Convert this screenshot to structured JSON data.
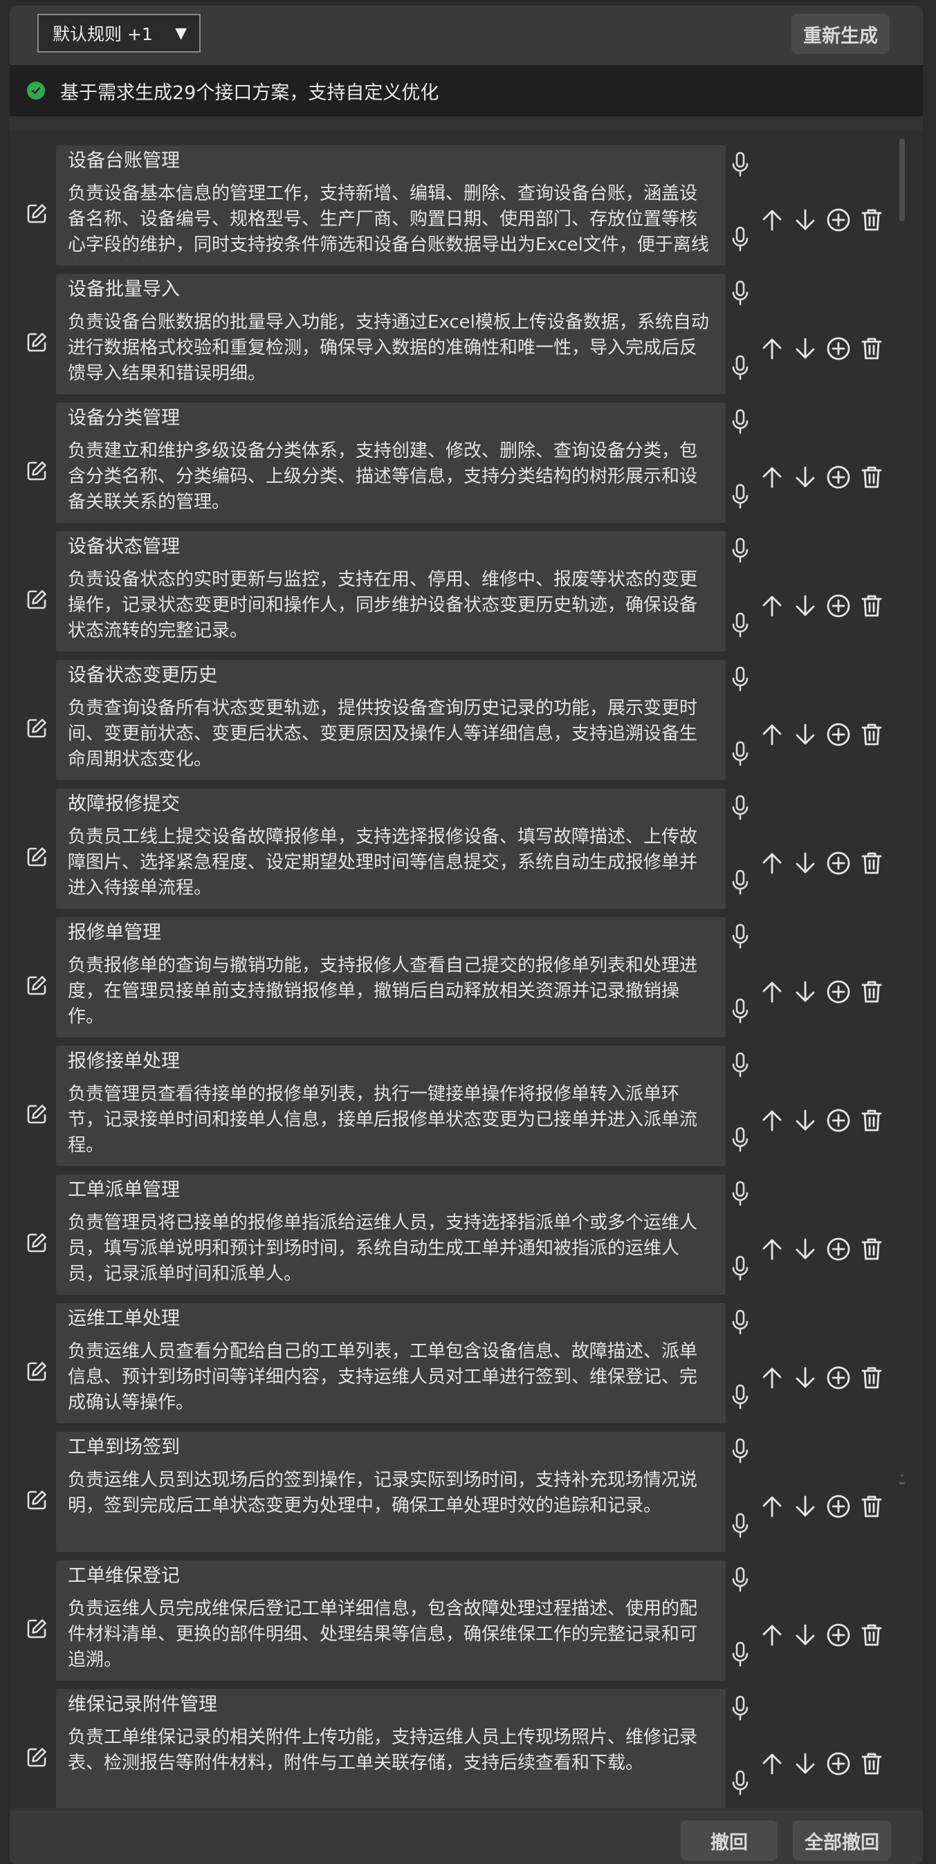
{
  "toolbar": {
    "rule_select_value": "默认规则 +1",
    "regenerate_label": "重新生成"
  },
  "status": {
    "message": "基于需求生成29个接口方案，支持自定义优化",
    "icon": "check-circle-icon",
    "color": "#2eaa4a"
  },
  "items": [
    {
      "title": "设备台账管理",
      "description": "负责设备基本信息的管理工作，支持新增、编辑、删除、查询设备台账，涵盖设备名称、设备编号、规格型号、生产厂商、购置日期、使用部门、存放位置等核心字段的维护，同时支持按条件筛选和设备台账数据导出为Excel文件，便于离线查看和数据备份。"
    },
    {
      "title": "设备批量导入",
      "description": "负责设备台账数据的批量导入功能，支持通过Excel模板上传设备数据，系统自动进行数据格式校验和重复检测，确保导入数据的准确性和唯一性，导入完成后反馈导入结果和错误明细。"
    },
    {
      "title": "设备分类管理",
      "description": "负责建立和维护多级设备分类体系，支持创建、修改、删除、查询设备分类，包含分类名称、分类编码、上级分类、描述等信息，支持分类结构的树形展示和设备关联关系的管理。"
    },
    {
      "title": "设备状态管理",
      "description": "负责设备状态的实时更新与监控，支持在用、停用、维修中、报废等状态的变更操作，记录状态变更时间和操作人，同步维护设备状态变更历史轨迹，确保设备状态流转的完整记录。"
    },
    {
      "title": "设备状态变更历史",
      "description": "负责查询设备所有状态变更轨迹，提供按设备查询历史记录的功能，展示变更时间、变更前状态、变更后状态、变更原因及操作人等详细信息，支持追溯设备生命周期状态变化。"
    },
    {
      "title": "故障报修提交",
      "description": "负责员工线上提交设备故障报修单，支持选择报修设备、填写故障描述、上传故障图片、选择紧急程度、设定期望处理时间等信息提交，系统自动生成报修单并进入待接单流程。"
    },
    {
      "title": "报修单管理",
      "description": "负责报修单的查询与撤销功能，支持报修人查看自己提交的报修单列表和处理进度，在管理员接单前支持撤销报修单，撤销后自动释放相关资源并记录撤销操作。"
    },
    {
      "title": "报修接单处理",
      "description": "负责管理员查看待接单的报修单列表，执行一键接单操作将报修单转入派单环节，记录接单时间和接单人信息，接单后报修单状态变更为已接单并进入派单流程。"
    },
    {
      "title": "工单派单管理",
      "description": "负责管理员将已接单的报修单指派给运维人员，支持选择指派单个或多个运维人员，填写派单说明和预计到场时间，系统自动生成工单并通知被指派的运维人员，记录派单时间和派单人。"
    },
    {
      "title": "运维工单处理",
      "description": "负责运维人员查看分配给自己的工单列表，工单包含设备信息、故障描述、派单信息、预计到场时间等详细内容，支持运维人员对工单进行签到、维保登记、完成确认等操作。"
    },
    {
      "title": "工单到场签到",
      "description": "负责运维人员到达现场后的签到操作，记录实际到场时间，支持补充现场情况说明，签到完成后工单状态变更为处理中，确保工单处理时效的追踪和记录。"
    },
    {
      "title": "工单维保登记",
      "description": "负责运维人员完成维保后登记工单详细信息，包含故障处理过程描述、使用的配件材料清单、更换的部件明细、处理结果等信息，确保维保工作的完整记录和可追溯。"
    },
    {
      "title": "维保记录附件管理",
      "description": "负责工单维保记录的相关附件上传功能，支持运维人员上传现场照片、维修记录表、检测报告等附件材料，附件与工单关联存储，支持后续查看和下载。"
    }
  ],
  "footer": {
    "undo_label": "撤回",
    "undo_all_label": "全部撤回"
  }
}
